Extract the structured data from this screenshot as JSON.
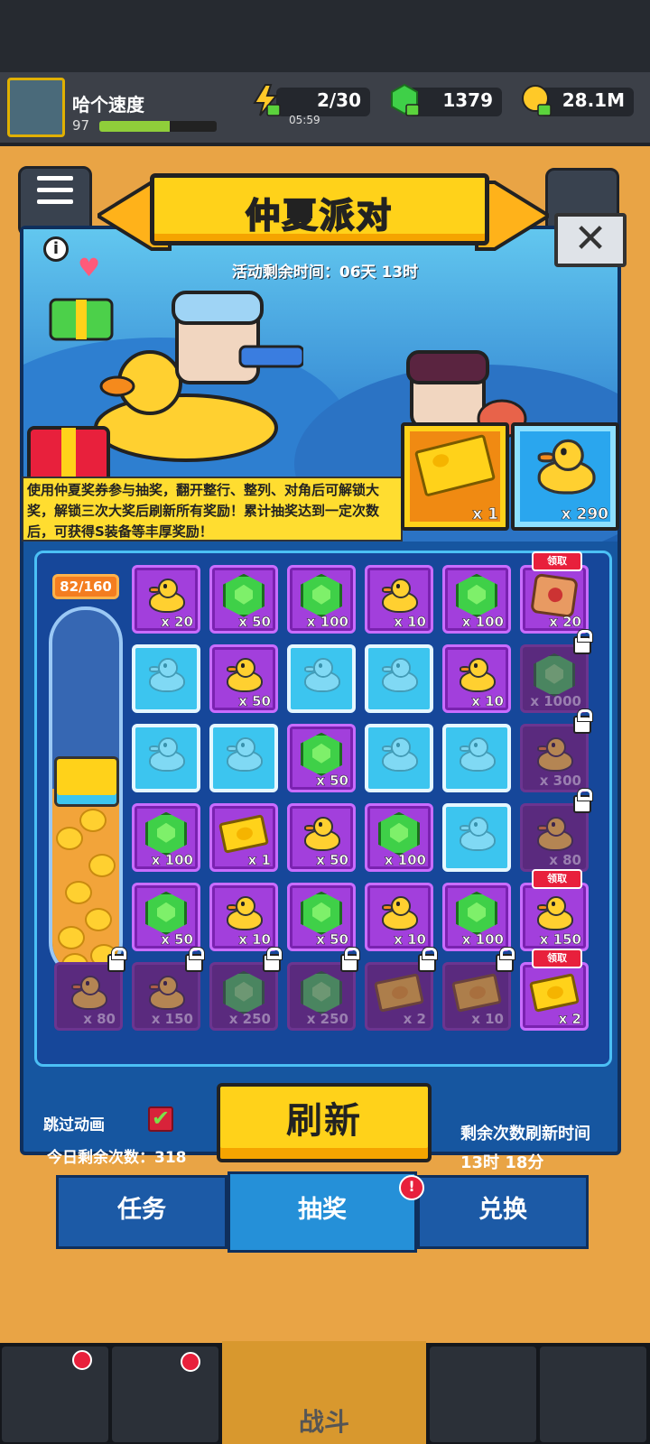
{
  "player": {
    "name": "哈个速度",
    "level": "97",
    "xp_fraction": 0.6
  },
  "resources": {
    "energy": "2/30",
    "energy_timer": "05:59",
    "gems": "1379",
    "gold": "28.1M"
  },
  "event": {
    "title": "仲夏派对",
    "timer": "活动剩余时间：06天 13时",
    "description": "使用仲夏奖券参与抽奖，翻开整行、整列、对角后可解锁大奖，解锁三次大奖后刷新所有奖励！累计抽奖达到一定次数后，可获得S装备等丰厚奖励！",
    "close_icon": "close-icon",
    "info_icon": "info-icon"
  },
  "currencies": {
    "ticket_count": "x 1",
    "duck_count": "x 290"
  },
  "progress": {
    "label": "82/160",
    "fraction": 0.5125
  },
  "claim_label": "领取",
  "grid": [
    [
      {
        "type": "purple",
        "icon": "duck",
        "count": "x 20"
      },
      {
        "type": "purple",
        "icon": "gem",
        "count": "x 50"
      },
      {
        "type": "purple",
        "icon": "gem",
        "count": "x 100"
      },
      {
        "type": "purple",
        "icon": "duck",
        "count": "x 10"
      },
      {
        "type": "purple",
        "icon": "gem",
        "count": "x 100"
      },
      {
        "type": "purple",
        "icon": "badge",
        "count": "x 20",
        "claim": true
      }
    ],
    [
      {
        "type": "blue",
        "icon": "duck",
        "count": ""
      },
      {
        "type": "purple",
        "icon": "duck",
        "count": "x 50"
      },
      {
        "type": "blue",
        "icon": "duck",
        "count": ""
      },
      {
        "type": "blue",
        "icon": "duck",
        "count": ""
      },
      {
        "type": "purple",
        "icon": "duck",
        "count": "x 10"
      },
      {
        "type": "dark",
        "icon": "gem",
        "count": "x 1000",
        "lock": true
      }
    ],
    [
      {
        "type": "blue",
        "icon": "duck",
        "count": ""
      },
      {
        "type": "blue",
        "icon": "duck",
        "count": ""
      },
      {
        "type": "purple",
        "icon": "gem",
        "count": "x 50"
      },
      {
        "type": "blue",
        "icon": "duck",
        "count": ""
      },
      {
        "type": "blue",
        "icon": "duck",
        "count": ""
      },
      {
        "type": "dark",
        "icon": "duck",
        "count": "x 300",
        "lock": true
      }
    ],
    [
      {
        "type": "purple",
        "icon": "gem",
        "count": "x 100"
      },
      {
        "type": "purple",
        "icon": "ticket",
        "count": "x 1"
      },
      {
        "type": "purple",
        "icon": "duck",
        "count": "x 50"
      },
      {
        "type": "purple",
        "icon": "gem",
        "count": "x 100"
      },
      {
        "type": "blue",
        "icon": "duck",
        "count": ""
      },
      {
        "type": "dark",
        "icon": "duck",
        "count": "x 80",
        "lock": true
      }
    ],
    [
      {
        "type": "purple",
        "icon": "gem",
        "count": "x 50"
      },
      {
        "type": "purple",
        "icon": "duck",
        "count": "x 10"
      },
      {
        "type": "purple",
        "icon": "gem",
        "count": "x 50"
      },
      {
        "type": "purple",
        "icon": "duck",
        "count": "x 10"
      },
      {
        "type": "purple",
        "icon": "gem",
        "count": "x 100"
      },
      {
        "type": "purple",
        "icon": "duck",
        "count": "x 150",
        "claim": true
      }
    ],
    [
      {
        "type": "dark",
        "icon": "duck",
        "count": "x 80",
        "lock": true
      },
      {
        "type": "dark",
        "icon": "duck",
        "count": "x 150",
        "lock": true
      },
      {
        "type": "dark",
        "icon": "gem",
        "count": "x 250",
        "lock": true
      },
      {
        "type": "dark",
        "icon": "gem",
        "count": "x 250",
        "lock": true
      },
      {
        "type": "dark",
        "icon": "ticket",
        "count": "x 2",
        "lock": true
      },
      {
        "type": "dark",
        "icon": "ticket",
        "count": "x 10",
        "lock": true
      },
      {
        "type": "purple",
        "icon": "ticket",
        "count": "x 2",
        "claim": true
      }
    ]
  ],
  "controls": {
    "skip_label": "跳过动画",
    "skip_checked": "✔",
    "remaining_today": "今日剩余次数：318",
    "refresh_label": "刷新",
    "refresh_info_line1": "剩余次数刷新时间",
    "refresh_info_line2": "13时 18分"
  },
  "tabs": [
    {
      "label": "任务"
    },
    {
      "label": "抽奖",
      "active": true,
      "alert": "!"
    },
    {
      "label": "兑换"
    }
  ],
  "bottom_nav": {
    "battle_label": "战斗"
  },
  "colors": {
    "accent": "#ffd21a",
    "panel": "#1656a0",
    "cell_purple": "#a23fdc",
    "cell_blue": "#3cc5ef"
  }
}
